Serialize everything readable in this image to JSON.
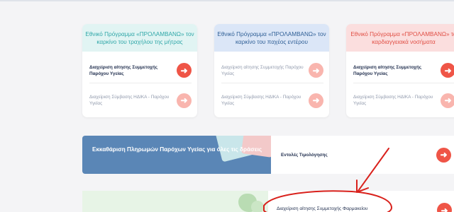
{
  "cards": [
    {
      "title": "Εθνικό Πρόγραμμα «ΠΡΟΛΑΜΒΑΝΩ» τον καρκίνο του τραχήλου της μήτρας",
      "row1": "Διαχείριση αίτησης Συμμετοχής Παρόχου Υγείας",
      "row2": "Διαχείριση Σύμβασης ΗΔΙΚΑ - Παρόχου Υγείας"
    },
    {
      "title": "Εθνικό Πρόγραμμα «ΠΡΟΛΑΜΒΑΝΩ» τον καρκίνο του παχέος εντέρου",
      "row1": "Διαχείριση αίτησης Συμμετοχής Παρόχου Υγείας",
      "row2": "Διαχείριση Σύμβασης ΗΔΙΚΑ - Παρόχου Υγείας"
    },
    {
      "title": "Εθνικό Πρόγραμμα «ΠΡΟΛΑΜΒΑΝΩ» τα καρδιαγγειακά νοσήματα",
      "row1": "Διαχείριση αίτησης Συμμετοχής Παρόχου Υγείας",
      "row2": "Διαχείριση Σύμβασης ΗΔΙΚΑ - Παρόχου Υγείας"
    }
  ],
  "banner": {
    "title": "Εκκαθάριση Πληρωμών Παρόχων Υγείας για όλες τις δράσεις",
    "right_label": "Εντολές Τιμολόγησης"
  },
  "panel": {
    "label": "Διαχείριση αίτησης Συμμετοχής Φαρμακείου"
  },
  "icons": {
    "arrow": "arrow-right-icon",
    "arrow_glyph": "➜"
  },
  "colors": {
    "card1_header": "#e1f4f3",
    "card1_title": "#2fa7a8",
    "card2_header": "#dbe6f7",
    "card2_title": "#2f5f96",
    "card3_header": "#fbdede",
    "card3_title": "#e04f45",
    "accent": "#ef5547",
    "accent_soft": "#f9b5ae",
    "banner_blue": "#5a86b6",
    "annotation_red": "#d9211c"
  }
}
